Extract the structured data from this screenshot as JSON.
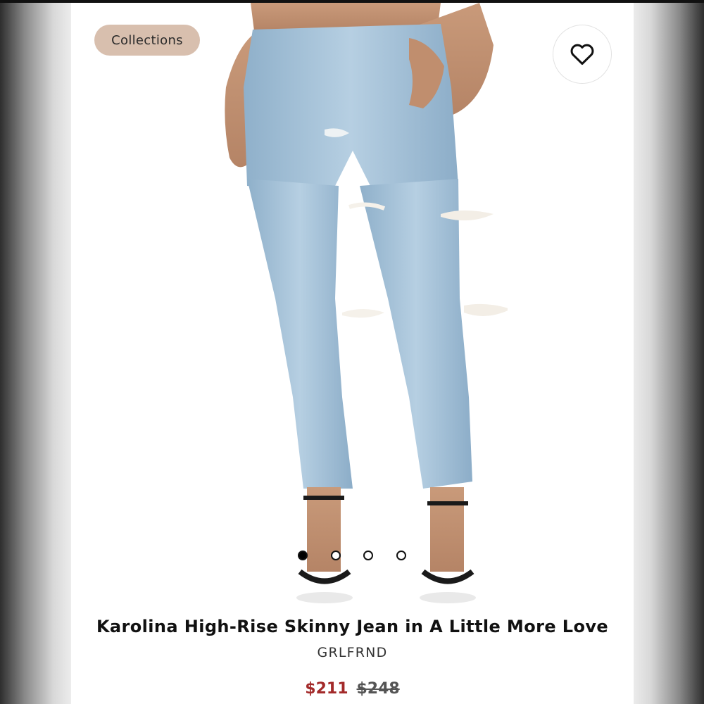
{
  "header": {
    "collections_label": "Collections"
  },
  "favorite": {
    "icon": "heart-outline-icon"
  },
  "carousel": {
    "slides": 4,
    "active_index": 0
  },
  "product": {
    "title": "Karolina High-Rise Skinny Jean in A Little More Love",
    "brand": "GRLFRND",
    "sale_price": "$211",
    "original_price": "$248"
  },
  "colors": {
    "chip_bg": "#d8bfae",
    "sale_price": "#a32a2a",
    "denim": "#9fbfd8"
  }
}
